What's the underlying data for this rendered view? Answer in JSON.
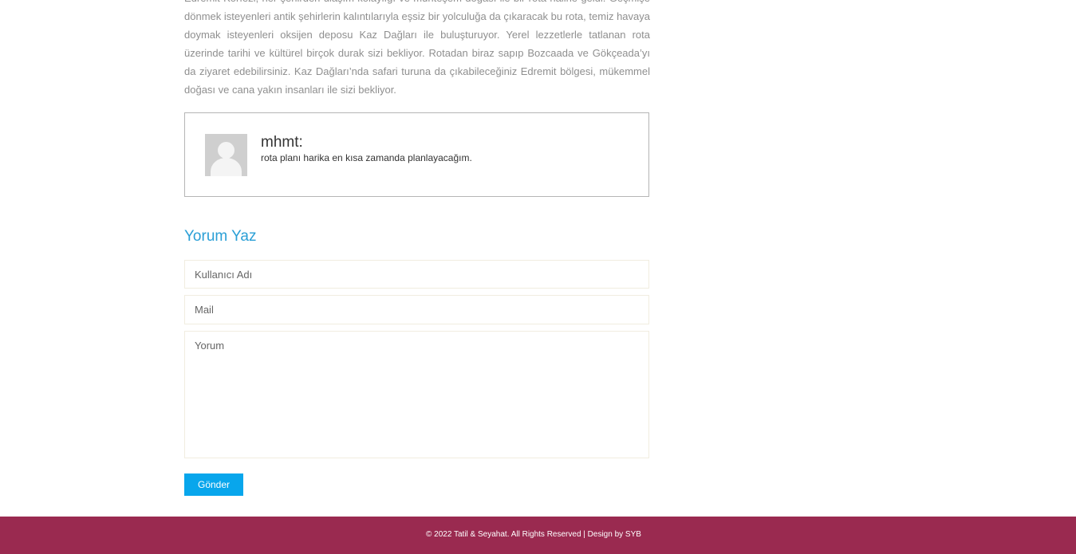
{
  "article": {
    "text": "Edremit Körfezi, her şehirden ulaşım kolaylığı ve muhteşem doğası ile bir rota haline geldi. Geçmişe dönmek isteyenleri antik şehirlerin kalıntılarıyla eşsiz bir yolculuğa da çıkaracak bu rota, temiz havaya doymak isteyenleri oksijen deposu Kaz Dağları ile buluşturuyor. Yerel lezzetlerle tatlanan rota üzerinde tarihi ve kültürel birçok durak sizi bekliyor. Rotadan biraz sapıp Bozcaada ve Gökçeada’yı da ziyaret edebilirsiniz. Kaz Dağları’nda safari turuna da çıkabileceğiniz Edremit bölgesi, mükemmel doğası ve cana yakın insanları ile sizi bekliyor."
  },
  "comments": [
    {
      "author": "mhmt:",
      "text": "rota planı harika en kısa zamanda planlayacağım.",
      "avatar_icon": "default-user-avatar"
    }
  ],
  "form": {
    "title": "Yorum Yaz",
    "username_placeholder": "Kullanıcı Adı",
    "mail_placeholder": "Mail",
    "comment_placeholder": "Yorum",
    "submit_label": "Gönder"
  },
  "footer": {
    "text": "© 2022 Tatil & Seyahat. All Rights Reserved | Design by SYB"
  },
  "colors": {
    "accent": "#2a9fd6",
    "button": "#08a6ec",
    "footer": "#9a2a50"
  }
}
